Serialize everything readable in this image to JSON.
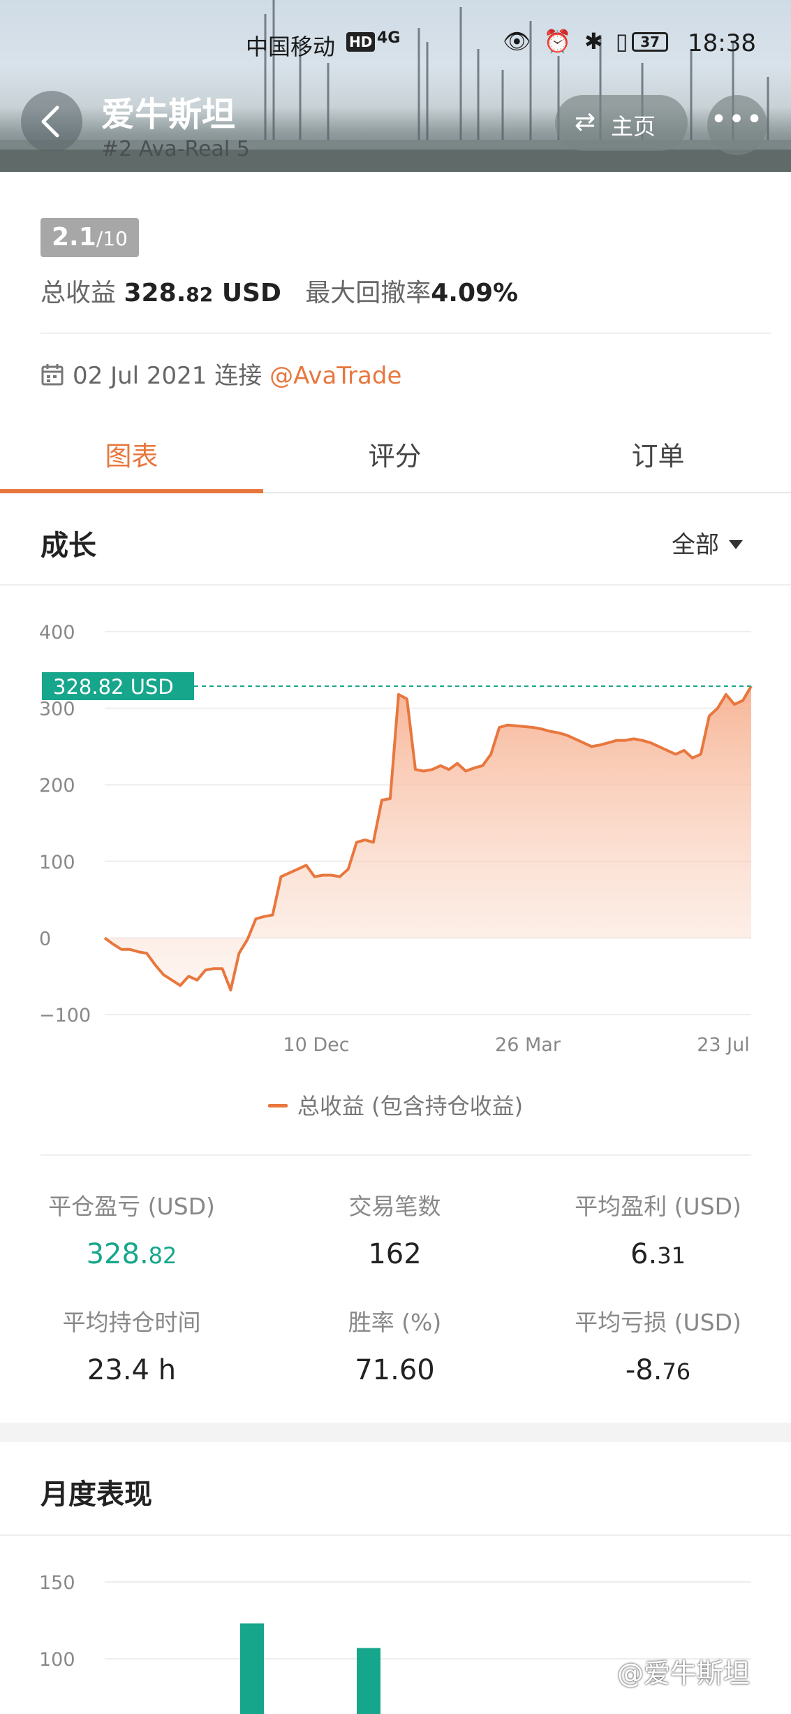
{
  "status_bar": {
    "carrier": "中国移动",
    "hd": "HD",
    "signal": "4G",
    "battery": "37",
    "time": "18:38",
    "icons": "👁 ⏰ ✱ ▯"
  },
  "header": {
    "title": "爱牛斯坦",
    "subtitle": "#2   Ava-Real 5",
    "home_label": "主页",
    "home_icon": "swap-icon",
    "more_icon": "more-icon"
  },
  "summary": {
    "rating_main": "2.1",
    "rating_scale": "/10",
    "total_profit_label": "总收益",
    "total_profit_int": "328.",
    "total_profit_cents": "82",
    "total_profit_unit": "USD",
    "max_drawdown_label": "最大回撤率",
    "max_drawdown_value": "4.09%",
    "connect_date": "02 Jul 2021",
    "connect_label": "连接",
    "broker": "@AvaTrade"
  },
  "tabs": [
    "图表",
    "评分",
    "订单"
  ],
  "growth": {
    "title": "成长",
    "filter": "全部",
    "legend": "总收益 (包含持仓收益)",
    "current_label": "328.82 USD"
  },
  "chart_data": [
    {
      "type": "area",
      "title": "",
      "series": [
        {
          "name": "总收益 (包含持仓收益)",
          "values": [
            0,
            -8,
            -15,
            -15,
            -18,
            -20,
            -35,
            -48,
            -55,
            -62,
            -50,
            -55,
            -42,
            -40,
            -40,
            -68,
            -20,
            -2,
            25,
            28,
            30,
            80,
            85,
            90,
            95,
            80,
            82,
            82,
            80,
            90,
            125,
            128,
            125,
            180,
            182,
            318,
            312,
            220,
            218,
            220,
            225,
            220,
            228,
            218,
            222,
            225,
            240,
            275,
            278,
            277,
            276,
            275,
            273,
            270,
            268,
            265,
            260,
            255,
            250,
            252,
            255,
            258,
            258,
            260,
            258,
            255,
            250,
            245,
            240,
            245,
            235,
            240,
            290,
            300,
            318,
            305,
            310,
            328.82
          ]
        }
      ],
      "x_ticks": [
        "10 Dec",
        "26 Mar",
        "23 Jul"
      ],
      "y_ticks": [
        400,
        300,
        200,
        100,
        0,
        -100
      ],
      "ylim": [
        -100,
        400
      ],
      "marker_value": 328.82,
      "colors": {
        "line": "#e8773e",
        "marker": "#16a68b"
      }
    },
    {
      "type": "bar",
      "title": "",
      "y_ticks": [
        150,
        100
      ],
      "values": [
        123,
        107
      ],
      "colors": {
        "bar": "#16a68b"
      }
    }
  ],
  "stats": [
    {
      "label": "平仓盈亏 (USD)",
      "int": "328.",
      "dec": "82",
      "positive": true
    },
    {
      "label": "交易笔数",
      "int": "162",
      "dec": ""
    },
    {
      "label": "平均盈利 (USD)",
      "int": "6.",
      "dec": "31"
    },
    {
      "label": "平均持仓时间",
      "int": "23.4 h",
      "dec": ""
    },
    {
      "label": "胜率 (%)",
      "int": "71.60",
      "dec": ""
    },
    {
      "label": "平均亏损 (USD)",
      "int": "-8.",
      "dec": "76"
    }
  ],
  "monthly": {
    "title": "月度表现"
  },
  "watermark": "@爱牛斯坦"
}
